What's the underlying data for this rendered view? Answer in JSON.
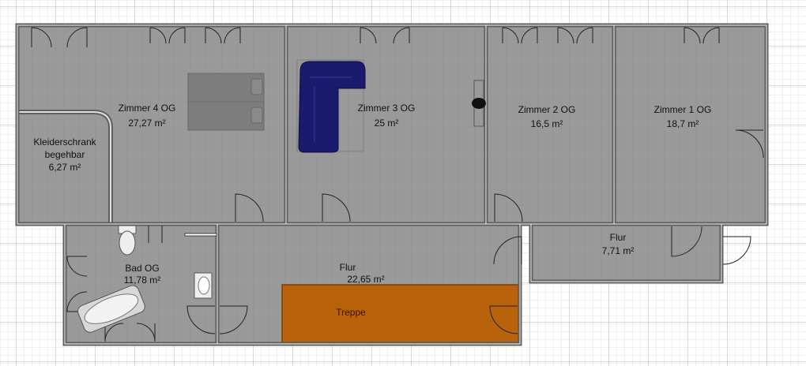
{
  "plan": {
    "rooms": [
      {
        "id": "zimmer4",
        "name": "Zimmer 4 OG",
        "area": "27,27 m²"
      },
      {
        "id": "zimmer3",
        "name": "Zimmer 3 OG",
        "area": "25 m²"
      },
      {
        "id": "zimmer2",
        "name": "Zimmer 2 OG",
        "area": "16,5 m²"
      },
      {
        "id": "zimmer1",
        "name": "Zimmer 1 OG",
        "area": "18,7 m²"
      },
      {
        "id": "kleiderschrank",
        "name_line1": "Kleiderschrank",
        "name_line2": "begehbar",
        "area": "6,27 m²"
      },
      {
        "id": "bad",
        "name": "Bad OG",
        "area": "11,78 m²"
      },
      {
        "id": "flur_main",
        "name": "Flur",
        "area": "22,65 m²"
      },
      {
        "id": "flur_right",
        "name": "Flur",
        "area": "7,71 m²"
      }
    ],
    "stairs_label": "Treppe",
    "colors": {
      "room_fill": "#999999",
      "wall": "#5f5f5f",
      "grid_fine": "#d6d6d6",
      "grid_major": "#b4b4b4",
      "stairs": "#b8620b",
      "stairs_border": "#7a3e06",
      "sofa": "#1a1a6e",
      "bed": "#7d7d7d"
    }
  }
}
